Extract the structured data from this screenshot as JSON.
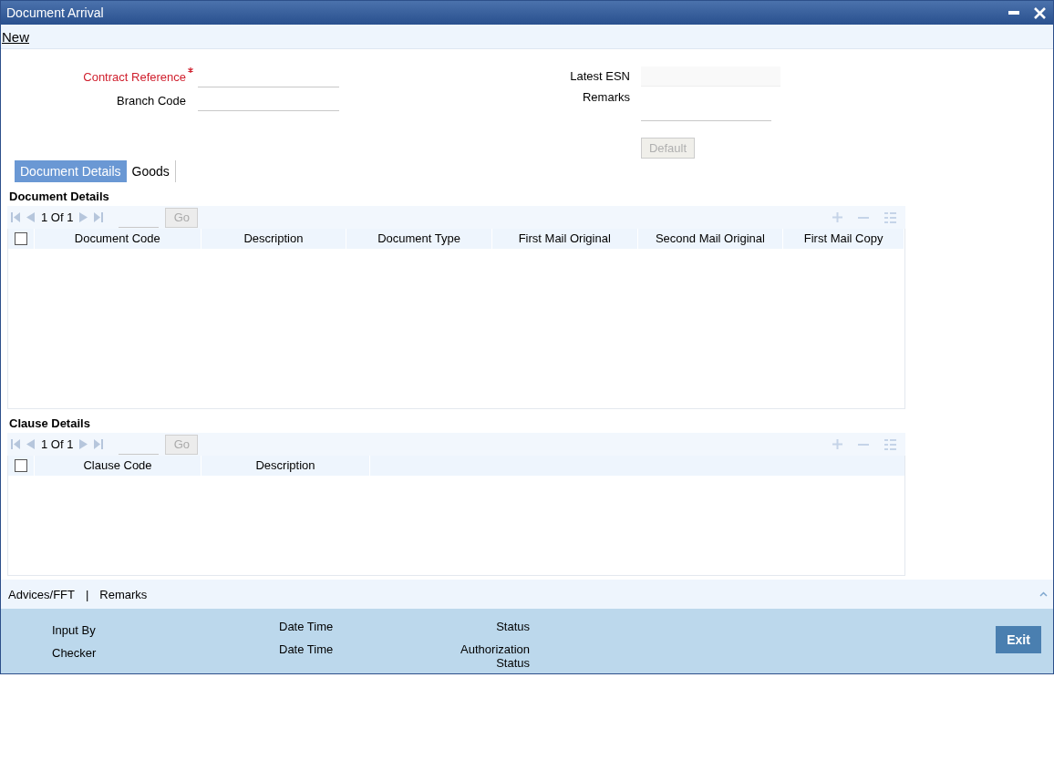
{
  "window": {
    "title": "Document Arrival"
  },
  "toolbar": {
    "new_link": "New"
  },
  "fields_left": [
    {
      "label": "Contract Reference",
      "required": true
    },
    {
      "label": "Branch Code",
      "required": false
    }
  ],
  "fields_right": [
    {
      "label": "Latest ESN",
      "required": false,
      "kind": "readonly"
    },
    {
      "label": "Remarks",
      "required": false,
      "kind": "textarea"
    }
  ],
  "default_button": {
    "label": "Default",
    "disabled": true
  },
  "tabs": [
    {
      "label": "Document Details",
      "selected": true
    },
    {
      "label": "Goods",
      "selected": false
    }
  ],
  "grids": [
    {
      "title": "Document Details",
      "pager": {
        "current": "1",
        "of": "Of",
        "total": "1",
        "go": "Go"
      },
      "columns": [
        "Document Code",
        "Description",
        "Document Type",
        "First Mail Original",
        "Second Mail Original",
        "First Mail Copy"
      ],
      "checked": false
    },
    {
      "title": "Clause Details",
      "pager": {
        "current": "1",
        "of": "Of",
        "total": "1",
        "go": "Go"
      },
      "columns": [
        "Clause Code",
        "Description"
      ],
      "checked": false
    }
  ],
  "footer_links": [
    "Advices/FFT",
    "|",
    "Remarks"
  ],
  "audit": {
    "input_by": "Input By",
    "checker": "Checker",
    "date_time_1": "Date Time",
    "date_time_2": "Date Time",
    "status": "Status",
    "authorization_status": "Authorization Status"
  },
  "exit_button": "Exit"
}
